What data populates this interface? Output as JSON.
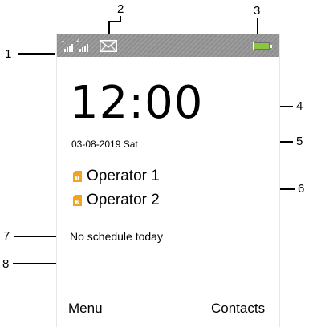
{
  "callouts": [
    "1",
    "2",
    "3",
    "4",
    "5",
    "6",
    "7",
    "8"
  ],
  "status_bar": {
    "sim1_label": "1",
    "sim2_label": "2",
    "icons": [
      "signal-sim1-icon",
      "signal-sim2-icon",
      "message-envelope-icon",
      "battery-icon"
    ],
    "battery_color": "#8cc63f"
  },
  "home": {
    "time": "12:00",
    "date": "03-08-2019 Sat",
    "operators": [
      {
        "sim": "1",
        "name": "Operator 1"
      },
      {
        "sim": "2",
        "name": "Operator 2"
      }
    ],
    "sim_icon_color": "#f0a420",
    "schedule": "No schedule today"
  },
  "softkeys": {
    "left": "Menu",
    "right": "Contacts"
  }
}
